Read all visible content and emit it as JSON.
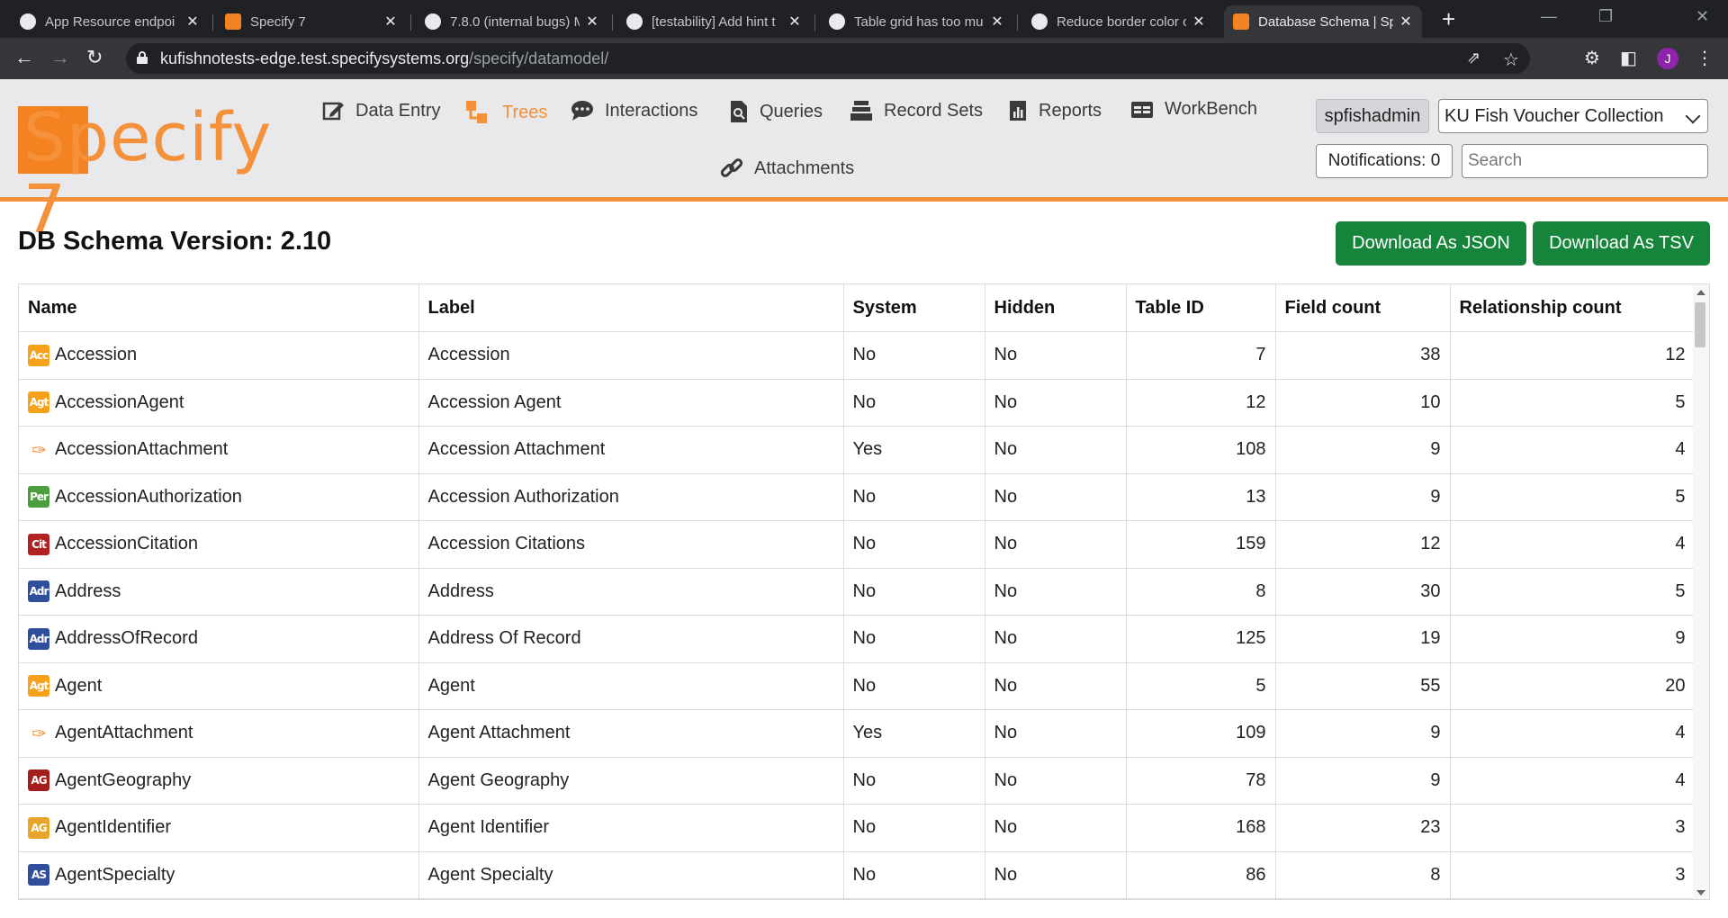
{
  "browser": {
    "tabs": [
      {
        "title": "App Resource endpoi",
        "icon": "github-icon"
      },
      {
        "title": "Specify 7",
        "icon": "specify-icon"
      },
      {
        "title": "7.8.0 (internal bugs) M",
        "icon": "github-icon"
      },
      {
        "title": "[testability] Add hint t",
        "icon": "github-icon"
      },
      {
        "title": "Table grid has too mu",
        "icon": "github-icon"
      },
      {
        "title": "Reduce border color c",
        "icon": "github-icon"
      },
      {
        "title": "Database Schema | Sp",
        "icon": "specify-icon"
      }
    ],
    "url_host": "kufishnotests-edge.test.specifysystems.org",
    "url_path": "/specify/datamodel/",
    "profile_initial": "J"
  },
  "app": {
    "logo_text": "Specify 7",
    "nav": [
      {
        "label": "Data Entry",
        "icon": "edit-icon"
      },
      {
        "label": "Trees",
        "icon": "tree-icon"
      },
      {
        "label": "Interactions",
        "icon": "chat-icon"
      },
      {
        "label": "Queries",
        "icon": "query-icon"
      },
      {
        "label": "Record Sets",
        "icon": "stack-icon"
      },
      {
        "label": "Reports",
        "icon": "report-icon"
      },
      {
        "label": "WorkBench",
        "icon": "table-icon"
      },
      {
        "label": "Attachments",
        "icon": "link-icon"
      }
    ],
    "active_nav": "Trees",
    "user": "spfishadmin",
    "collection": "KU Fish Voucher Collection",
    "notifications": "Notifications: 0",
    "search_placeholder": "Search"
  },
  "main": {
    "title": "DB Schema Version: 2.10",
    "download_json": "Download As JSON",
    "download_tsv": "Download As TSV",
    "columns": [
      "Name",
      "Label",
      "System",
      "Hidden",
      "Table ID",
      "Field count",
      "Relationship count"
    ],
    "rows": [
      {
        "icon": "Acc",
        "icon_color": "#f5a11a",
        "name": "Accession",
        "label": "Accession",
        "system": "No",
        "hidden": "No",
        "table_id": "7",
        "fields": "38",
        "rels": "12"
      },
      {
        "icon": "Agt",
        "icon_color": "#f5a11a",
        "name": "AccessionAgent",
        "label": "Accession Agent",
        "system": "No",
        "hidden": "No",
        "table_id": "12",
        "fields": "10",
        "rels": "5"
      },
      {
        "icon": "clip",
        "icon_color": "#f4913a",
        "name": "AccessionAttachment",
        "label": "Accession Attachment",
        "system": "Yes",
        "hidden": "No",
        "table_id": "108",
        "fields": "9",
        "rels": "4"
      },
      {
        "icon": "Per",
        "icon_color": "#4a9e3c",
        "name": "AccessionAuthorization",
        "label": "Accession Authorization",
        "system": "No",
        "hidden": "No",
        "table_id": "13",
        "fields": "9",
        "rels": "5"
      },
      {
        "icon": "Cit",
        "icon_color": "#b22222",
        "name": "AccessionCitation",
        "label": "Accession Citations",
        "system": "No",
        "hidden": "No",
        "table_id": "159",
        "fields": "12",
        "rels": "4"
      },
      {
        "icon": "Adr",
        "icon_color": "#2f4e9c",
        "name": "Address",
        "label": "Address",
        "system": "No",
        "hidden": "No",
        "table_id": "8",
        "fields": "30",
        "rels": "5"
      },
      {
        "icon": "Adr",
        "icon_color": "#2f4e9c",
        "name": "AddressOfRecord",
        "label": "Address Of Record",
        "system": "No",
        "hidden": "No",
        "table_id": "125",
        "fields": "19",
        "rels": "9"
      },
      {
        "icon": "Agt",
        "icon_color": "#f5a11a",
        "name": "Agent",
        "label": "Agent",
        "system": "No",
        "hidden": "No",
        "table_id": "5",
        "fields": "55",
        "rels": "20"
      },
      {
        "icon": "clip",
        "icon_color": "#f4913a",
        "name": "AgentAttachment",
        "label": "Agent Attachment",
        "system": "Yes",
        "hidden": "No",
        "table_id": "109",
        "fields": "9",
        "rels": "4"
      },
      {
        "icon": "AG",
        "icon_color": "#a31d1d",
        "name": "AgentGeography",
        "label": "Agent Geography",
        "system": "No",
        "hidden": "No",
        "table_id": "78",
        "fields": "9",
        "rels": "4"
      },
      {
        "icon": "AG",
        "icon_color": "#e8a628",
        "name": "AgentIdentifier",
        "label": "Agent Identifier",
        "system": "No",
        "hidden": "No",
        "table_id": "168",
        "fields": "23",
        "rels": "3"
      },
      {
        "icon": "AS",
        "icon_color": "#2f4e9c",
        "name": "AgentSpecialty",
        "label": "Agent Specialty",
        "system": "No",
        "hidden": "No",
        "table_id": "86",
        "fields": "8",
        "rels": "3"
      }
    ]
  }
}
